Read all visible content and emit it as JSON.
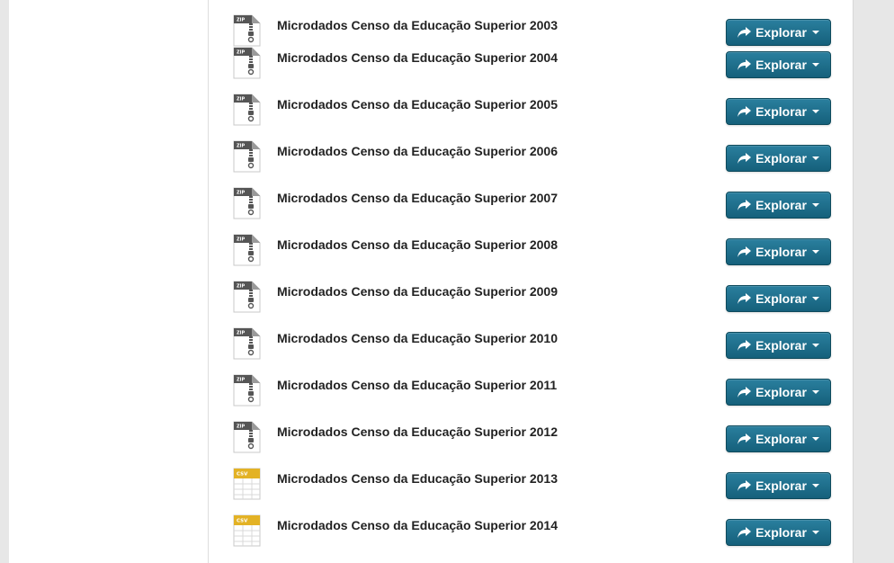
{
  "resources": [
    {
      "title": "Microdados Censo da Educação Superior 2003",
      "format": "ZIP",
      "icon": "zip-file-icon",
      "action_label": "Explorar"
    },
    {
      "title": "Microdados Censo da Educação Superior 2004",
      "format": "ZIP",
      "icon": "zip-file-icon",
      "action_label": "Explorar"
    },
    {
      "title": "Microdados Censo da Educação Superior 2005",
      "format": "ZIP",
      "icon": "zip-file-icon",
      "action_label": "Explorar"
    },
    {
      "title": "Microdados Censo da Educação Superior 2006",
      "format": "ZIP",
      "icon": "zip-file-icon",
      "action_label": "Explorar"
    },
    {
      "title": "Microdados Censo da Educação Superior 2007",
      "format": "ZIP",
      "icon": "zip-file-icon",
      "action_label": "Explorar"
    },
    {
      "title": "Microdados Censo da Educação Superior 2008",
      "format": "ZIP",
      "icon": "zip-file-icon",
      "action_label": "Explorar"
    },
    {
      "title": "Microdados Censo da Educação Superior 2009",
      "format": "ZIP",
      "icon": "zip-file-icon",
      "action_label": "Explorar"
    },
    {
      "title": "Microdados Censo da Educação Superior 2010",
      "format": "ZIP",
      "icon": "zip-file-icon",
      "action_label": "Explorar"
    },
    {
      "title": "Microdados Censo da Educação Superior 2011",
      "format": "ZIP",
      "icon": "zip-file-icon",
      "action_label": "Explorar"
    },
    {
      "title": "Microdados Censo da Educação Superior 2012",
      "format": "ZIP",
      "icon": "zip-file-icon",
      "action_label": "Explorar"
    },
    {
      "title": "Microdados Censo da Educação Superior 2013",
      "format": "CSV",
      "icon": "csv-file-icon",
      "action_label": "Explorar"
    },
    {
      "title": "Microdados Censo da Educação Superior 2014",
      "format": "CSV",
      "icon": "csv-file-icon",
      "action_label": "Explorar"
    }
  ],
  "colors": {
    "button_top": "#2a7f9e",
    "button_bottom": "#15607b",
    "zip_icon": "#555555",
    "csv_icon": "#e3b225",
    "page_background": "#e7e7e7"
  }
}
